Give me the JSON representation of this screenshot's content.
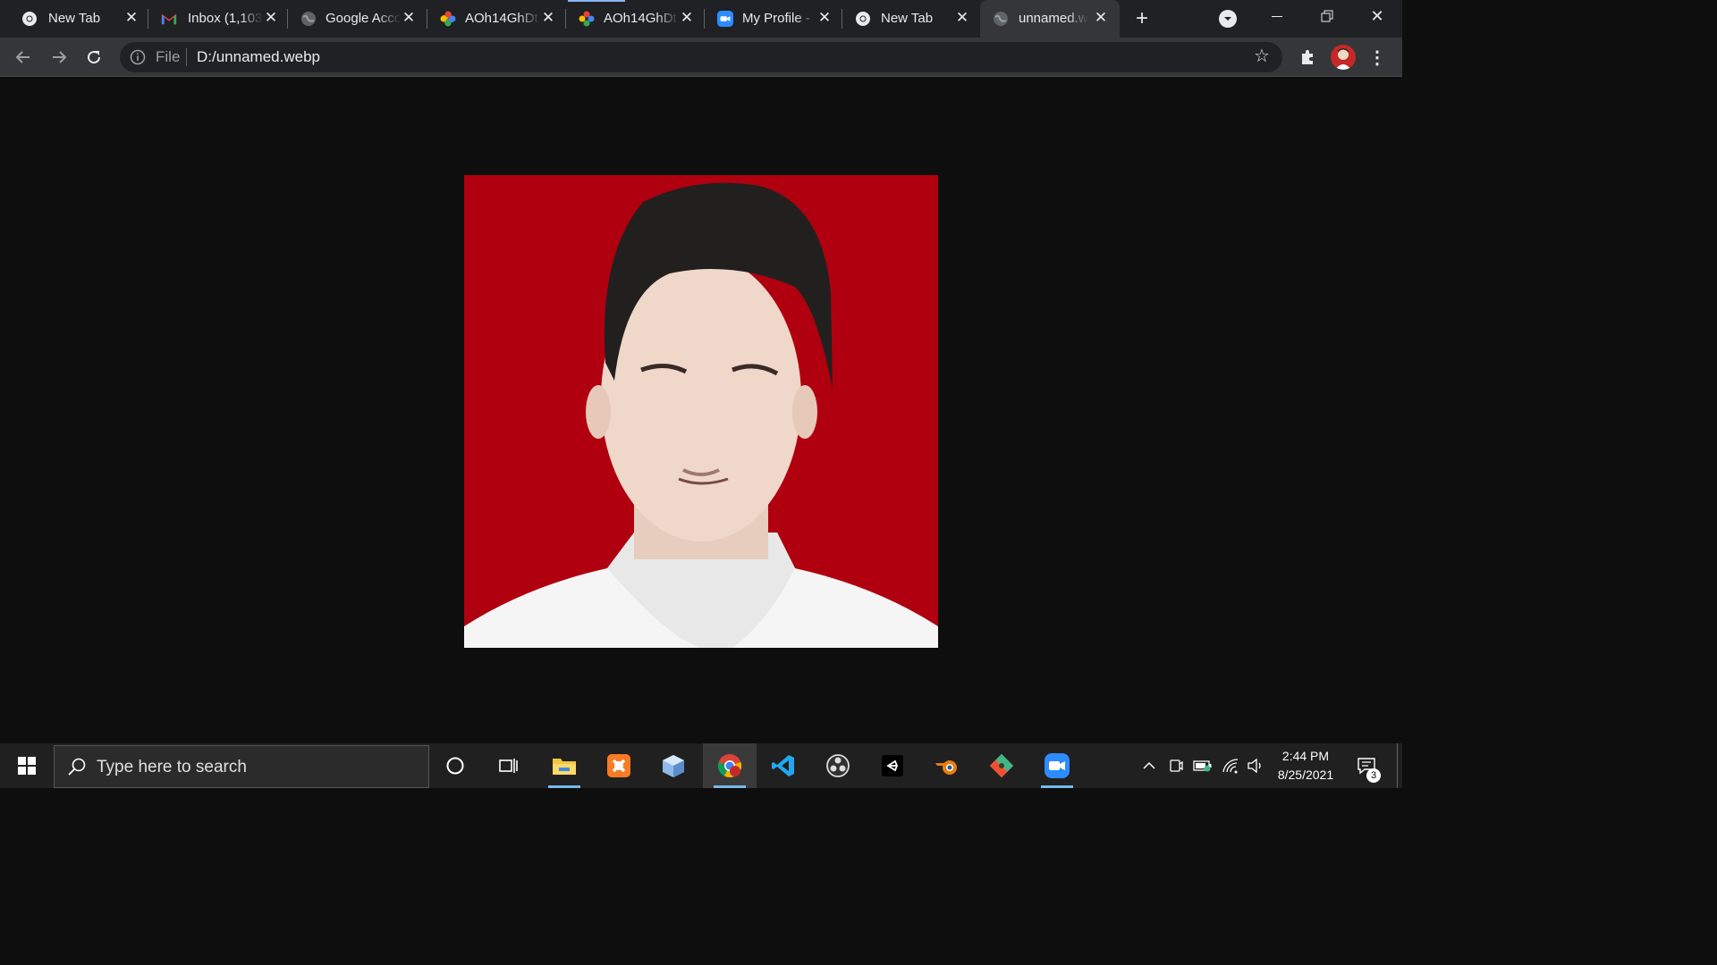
{
  "browser": {
    "tabs": [
      {
        "title": "New Tab",
        "icon": "chrome-icon"
      },
      {
        "title": "Inbox (1,103",
        "icon": "gmail-icon"
      },
      {
        "title": "Google Acco",
        "icon": "globe-icon"
      },
      {
        "title": "AOh14GhDt",
        "icon": "google-photos-icon"
      },
      {
        "title": "AOh14GhDt",
        "icon": "google-photos-icon"
      },
      {
        "title": "My Profile -",
        "icon": "zoom-icon"
      },
      {
        "title": "New Tab",
        "icon": "chrome-icon"
      },
      {
        "title": "unnamed.w",
        "icon": "globe-icon",
        "active": true
      }
    ],
    "address": {
      "scheme_label": "File",
      "url": "D:/unnamed.webp"
    }
  },
  "viewer": {
    "image_background": "#b0000f",
    "page_background": "#0e0e0e"
  },
  "taskbar": {
    "search_placeholder": "Type here to search",
    "apps": [
      "cortana-icon",
      "task-view-icon",
      "file-explorer-icon",
      "xampp-icon",
      "virtualbox-icon",
      "chrome-icon",
      "vscode-icon",
      "obs-icon",
      "unity-icon",
      "blender-icon",
      "git-icon",
      "zoom-icon"
    ],
    "clock": {
      "time": "2:44 PM",
      "date": "8/25/2021"
    },
    "notifications_count": "3"
  },
  "colors": {
    "tabbar": "#202124",
    "toolbar": "#35363a",
    "taskbar": "#202020",
    "accent": "#76b9ed"
  }
}
